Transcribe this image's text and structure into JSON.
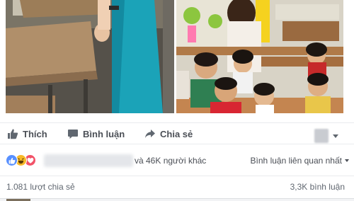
{
  "post": {
    "photos": [
      {
        "name": "classroom-teacher-desk"
      },
      {
        "name": "classroom-children"
      }
    ]
  },
  "actions": {
    "like_label": "Thích",
    "comment_label": "Bình luận",
    "share_label": "Chia sẻ"
  },
  "reactions": {
    "icons": [
      "like-icon",
      "haha-icon",
      "love-icon"
    ],
    "summary_text": "và 46K người khác",
    "sort_label": "Bình luận liên quan nhất"
  },
  "stats": {
    "shares_text": "1.081 lượt chia sẻ",
    "comments_text": "3,3K bình luận"
  },
  "colors": {
    "like_blue": "#5890ff",
    "haha_yellow": "#f7b928",
    "love_red": "#f25268",
    "text_secondary": "#4b4f56"
  }
}
